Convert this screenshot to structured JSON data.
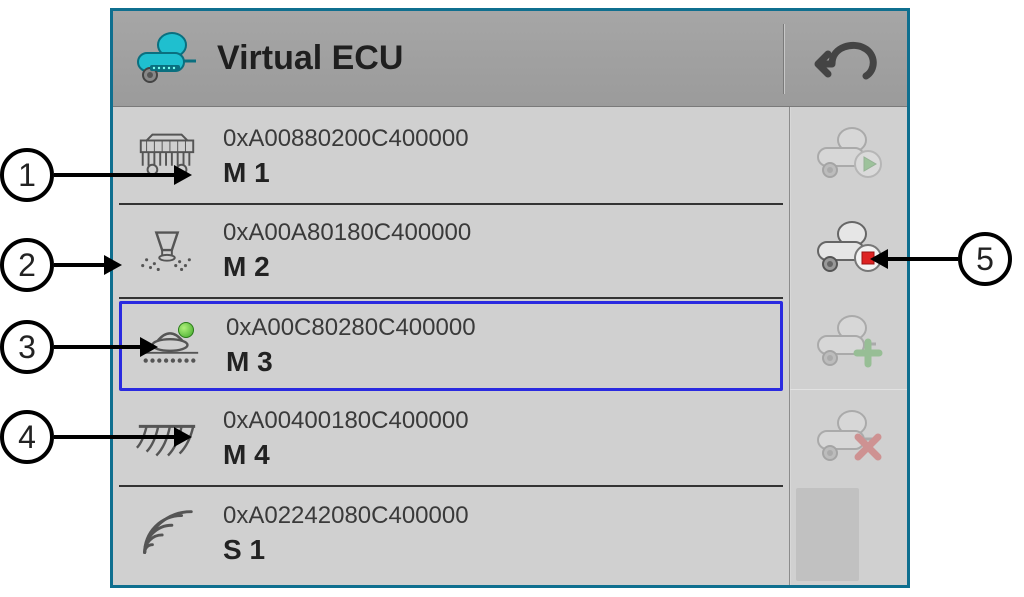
{
  "header": {
    "title": "Virtual ECU"
  },
  "items": [
    {
      "addr": "0xA00880200C400000",
      "name": "M 1",
      "icon": "seed-drill",
      "active": false,
      "selected": false
    },
    {
      "addr": "0xA00A80180C400000",
      "name": "M 2",
      "icon": "spreader",
      "active": false,
      "selected": false
    },
    {
      "addr": "0xA00C80280C400000",
      "name": "M 3",
      "icon": "planter",
      "active": true,
      "selected": true
    },
    {
      "addr": "0xA00400180C400000",
      "name": "M 4",
      "icon": "plough",
      "active": false,
      "selected": false
    },
    {
      "addr": "0xA02242080C400000",
      "name": "S 1",
      "icon": "radio-waves",
      "active": false,
      "selected": false
    }
  ],
  "actions": {
    "play_disabled": true,
    "stop_disabled": false,
    "add_disabled": true,
    "delete_disabled": true
  },
  "callouts": {
    "c1": "1",
    "c2": "2",
    "c3": "3",
    "c4": "4",
    "c5": "5"
  }
}
